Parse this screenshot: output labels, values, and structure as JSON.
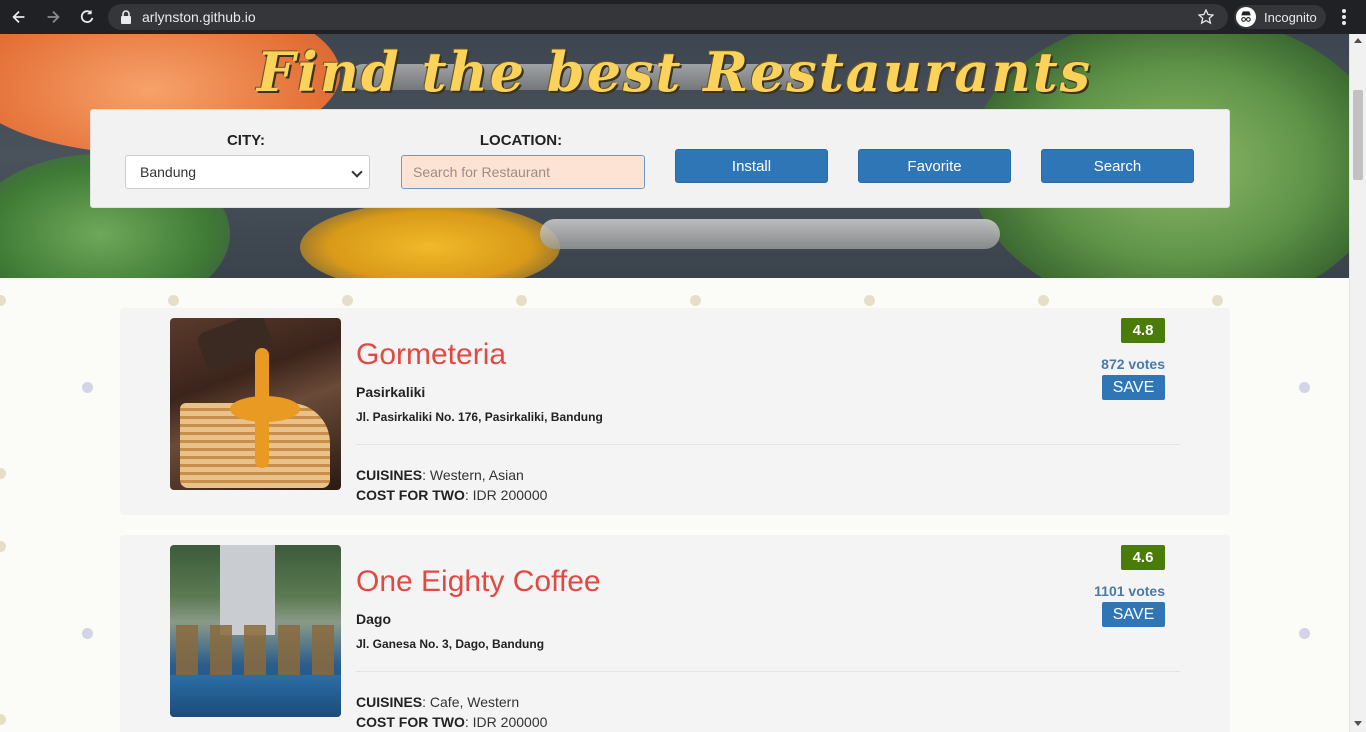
{
  "browser": {
    "url": "arlynston.github.io",
    "profile_label": "Incognito"
  },
  "hero": {
    "title": "Find the best Restaurants"
  },
  "search": {
    "city_label": "CITY:",
    "city_value": "Bandung",
    "location_label": "LOCATION:",
    "location_placeholder": "Search for Restaurant",
    "install_label": "Install",
    "favorite_label": "Favorite",
    "search_label": "Search"
  },
  "restaurants": [
    {
      "name": "Gormeteria",
      "area": "Pasirkaliki",
      "address": "Jl. Pasirkaliki No. 176, Pasirkaliki, Bandung",
      "cuisines_label": "CUISINES",
      "cuisines": ": Western, Asian",
      "cost_label": "COST FOR TWO",
      "cost": ": IDR 200000",
      "rating": "4.8",
      "votes": "872 votes",
      "save_label": "SAVE"
    },
    {
      "name": "One Eighty Coffee",
      "area": "Dago",
      "address": "Jl. Ganesa No. 3, Dago, Bandung",
      "cuisines_label": "CUISINES",
      "cuisines": ": Cafe, Western",
      "cost_label": "COST FOR TWO",
      "cost": ": IDR 200000",
      "rating": "4.6",
      "votes": "1101 votes",
      "save_label": "SAVE"
    }
  ],
  "colors": {
    "accent_blue": "#2f76b7",
    "title_red": "#e04a43",
    "rating_green": "#4a7c0a",
    "hero_title": "#fbd35a"
  }
}
